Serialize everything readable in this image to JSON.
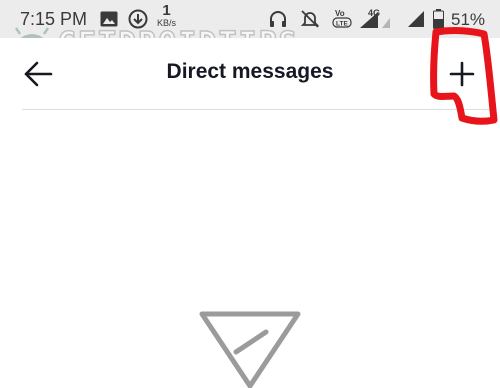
{
  "status_bar": {
    "time": "7:15 PM",
    "net_speed_value": "1",
    "net_speed_unit": "KB/s",
    "battery_percent": "51%",
    "network_type": "4G",
    "volte_label": "Vo LTE",
    "icons": [
      "image-icon",
      "download-icon",
      "headphones-icon",
      "mute-icon",
      "signal-icon",
      "battery-icon"
    ]
  },
  "watermark": {
    "text": "GETDROIDTIPS"
  },
  "header": {
    "title": "Direct messages",
    "back_icon": "arrow-left-icon",
    "add_icon": "plus-icon"
  },
  "annotation": {
    "color": "#e8141c",
    "shape": "hand-drawn-circle"
  },
  "empty_state": {
    "icon": "paper-plane-icon"
  },
  "colors": {
    "status_bar_bg": "#ececec",
    "title_text": "#161823",
    "icon_gray": "#9b9b9b"
  }
}
